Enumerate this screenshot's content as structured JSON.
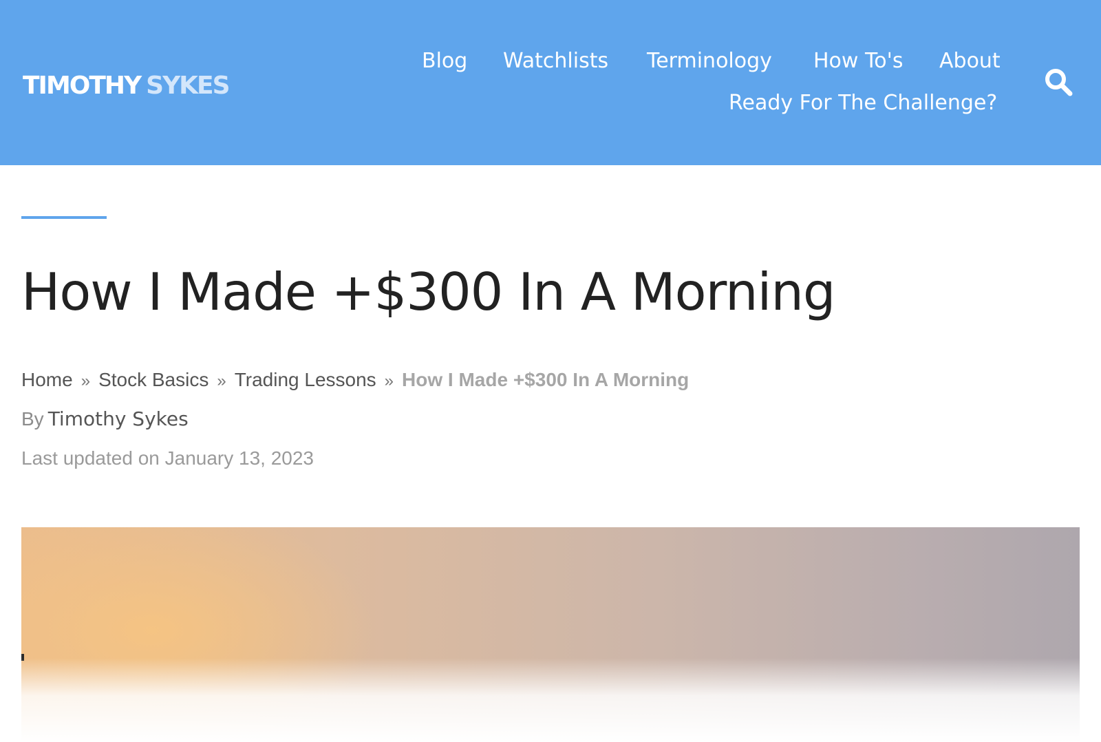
{
  "header": {
    "logo": {
      "first": "TIMOTHY",
      "second": "SYKES"
    },
    "nav": [
      {
        "label": "Blog"
      },
      {
        "label": "Watchlists"
      },
      {
        "label": "Terminology"
      },
      {
        "label": "How To's"
      },
      {
        "label": "About"
      },
      {
        "label": "Ready For The Challenge?"
      }
    ],
    "search_icon": "search-icon",
    "background_color": "#5fa5ec"
  },
  "article": {
    "title": "How I Made +$300 In A Morning",
    "breadcrumb": {
      "items": [
        "Home",
        "Stock Basics",
        "Trading Lessons"
      ],
      "separator": "»",
      "current": "How I Made +$300 In A Morning"
    },
    "byline": {
      "prefix": "By",
      "author": "Timothy Sykes"
    },
    "updated": "Last updated on January 13, 2023"
  },
  "colors": {
    "accent": "#5fa5ec",
    "title_text": "#222222"
  }
}
